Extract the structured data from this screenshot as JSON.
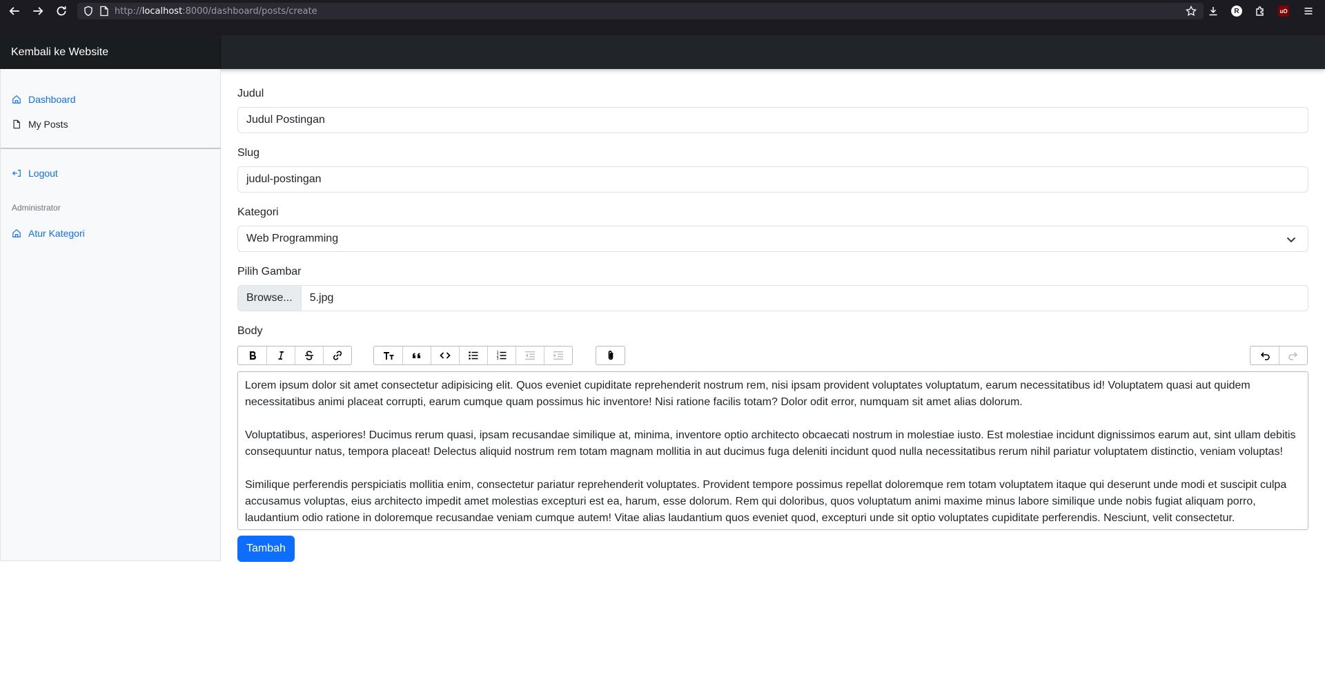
{
  "browser": {
    "url_prefix": "http://",
    "url_host": "localhost",
    "url_rest": ":8000/dashboard/posts/create",
    "profile_initial": "R",
    "ublock_label": "uO"
  },
  "header": {
    "brand": "Kembali ke Website"
  },
  "sidebar": {
    "items": [
      {
        "label": "Dashboard",
        "icon": "home-icon"
      },
      {
        "label": "My Posts",
        "icon": "file-icon"
      }
    ],
    "logout": {
      "label": "Logout",
      "icon": "logout-icon"
    },
    "admin_heading": "Administrator",
    "admin_items": [
      {
        "label": "Atur Kategori",
        "icon": "grid-icon"
      }
    ]
  },
  "form": {
    "title_label": "Judul",
    "title_value": "Judul Postingan",
    "slug_label": "Slug",
    "slug_value": "judul-postingan",
    "category_label": "Kategori",
    "category_value": "Web Programming",
    "image_label": "Pilih Gambar",
    "image_button": "Browse...",
    "image_file": "5.jpg",
    "body_label": "Body",
    "body_paragraphs": [
      "Lorem ipsum dolor sit amet consectetur adipisicing elit. Quos eveniet cupiditate reprehenderit nostrum rem, nisi ipsam provident voluptates voluptatum, earum necessitatibus id! Voluptatem quasi aut quidem necessitatibus animi placeat corrupti, earum cumque quam possimus hic inventore! Nisi ratione facilis totam? Dolor odit error, numquam sit amet alias dolorum.",
      "Voluptatibus, asperiores! Ducimus rerum quasi, ipsam recusandae similique at, minima, inventore optio architecto obcaecati nostrum in molestiae iusto. Est molestiae incidunt dignissimos earum aut, sint ullam debitis consequuntur natus, tempora placeat! Delectus aliquid nostrum rem totam magnam mollitia in aut ducimus fuga deleniti incidunt quod nulla necessitatibus rerum nihil pariatur voluptatem distinctio, veniam voluptas!",
      "Similique perferendis perspiciatis mollitia enim, consectetur pariatur reprehenderit voluptates. Provident tempore possimus repellat doloremque rem totam voluptatem itaque qui deserunt unde modi et suscipit culpa accusamus voluptas, eius architecto impedit amet molestias excepturi est ea, harum, esse dolorum. Rem qui doloribus, quos voluptatum animi maxime minus labore similique unde nobis fugiat aliquam porro, laudantium odio ratione in doloremque recusandae veniam cumque autem! Vitae alias laudantium quos eveniet quod, excepturi unde sit optio voluptates cupiditate perferendis. Nesciunt, velit consectetur."
    ],
    "submit_label": "Tambah"
  },
  "colors": {
    "primary": "#0d6efd",
    "header_bg": "#212529",
    "brand_bg": "#1a1d20",
    "sidebar_bg": "#f8f9fa"
  }
}
